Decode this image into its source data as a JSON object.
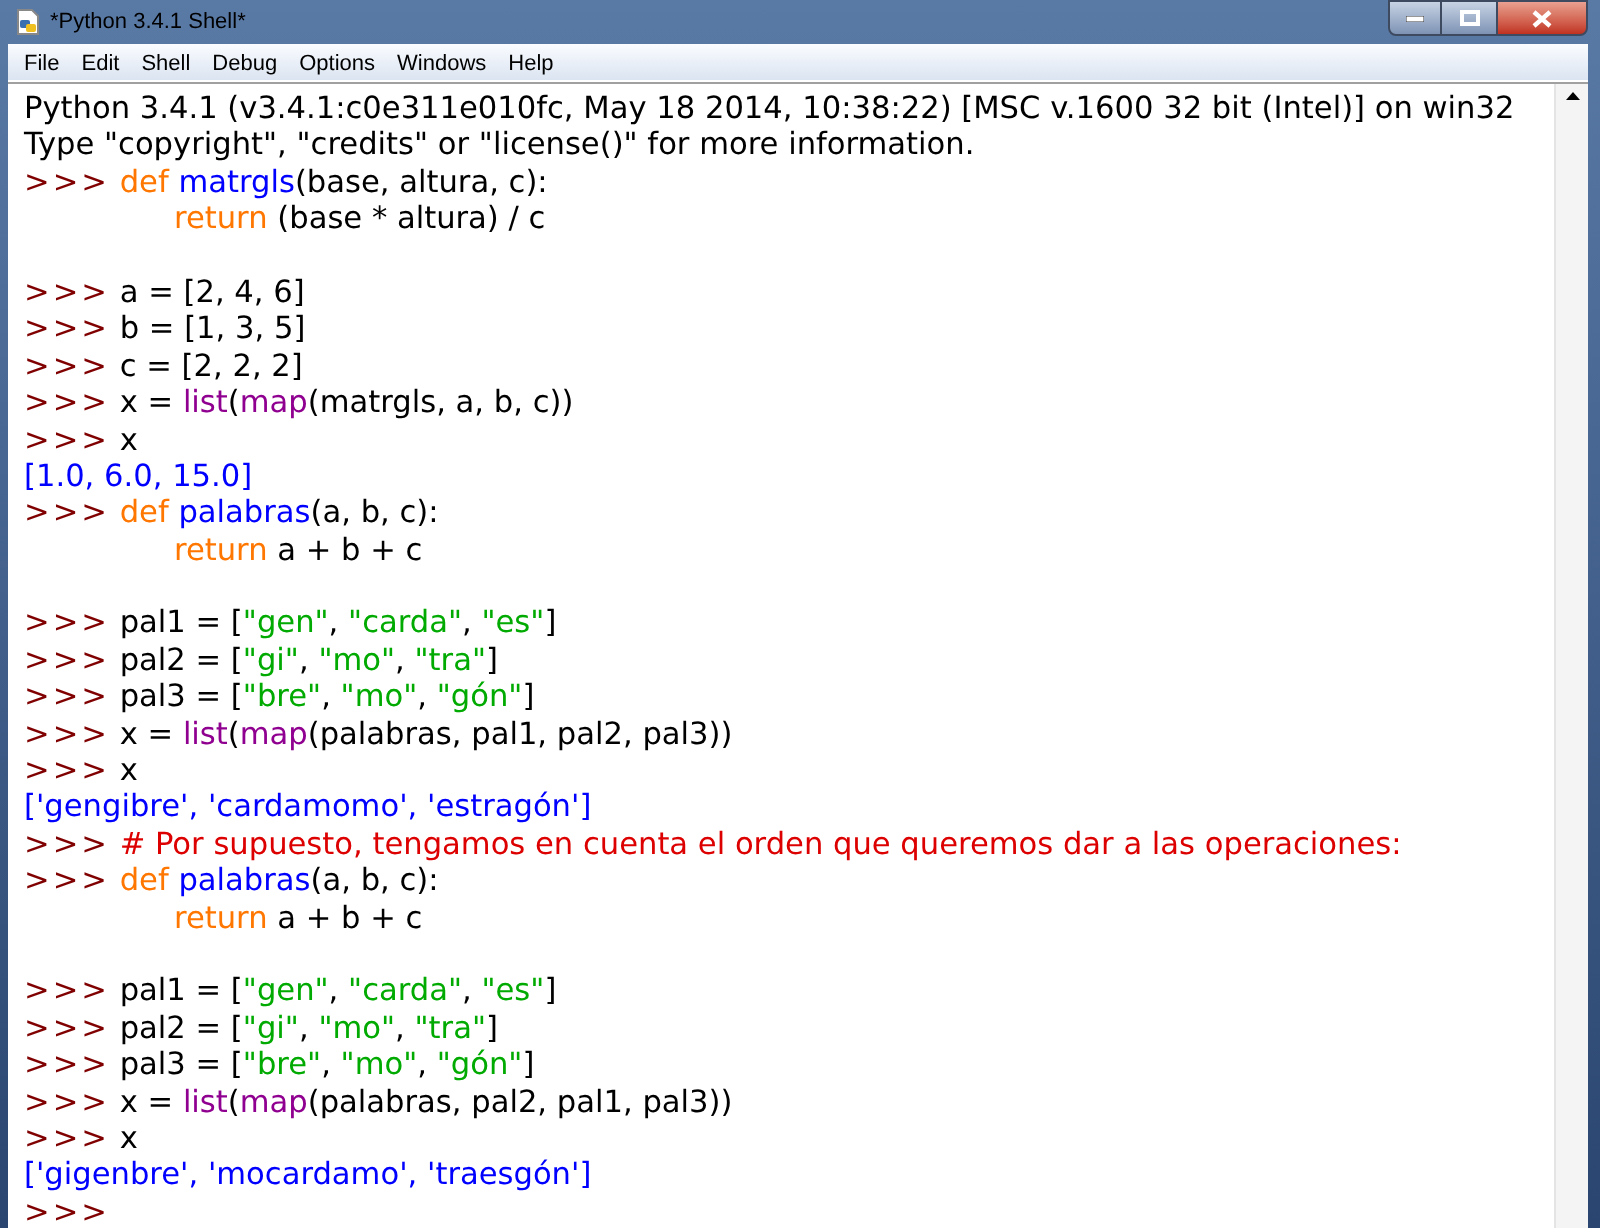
{
  "window": {
    "title": "*Python 3.4.1 Shell*"
  },
  "menu": [
    {
      "label": "File"
    },
    {
      "label": "Edit"
    },
    {
      "label": "Shell"
    },
    {
      "label": "Debug"
    },
    {
      "label": "Options"
    },
    {
      "label": "Windows"
    },
    {
      "label": "Help"
    }
  ],
  "lines": [
    {
      "kind": "banner",
      "tokens": [
        {
          "text": "Python 3.4.1 (v3.4.1:c0e311e010fc, May 18 2014, 10:38:22) [MSC v.1600 32 bit (Intel)] on win32",
          "kind": "plain"
        }
      ]
    },
    {
      "kind": "banner",
      "tokens": [
        {
          "text": "Type \"copyright\", \"credits\" or \"license()\" for more information.",
          "kind": "plain"
        }
      ]
    },
    {
      "kind": "input",
      "prompt": ">>>",
      "tokens": [
        {
          "text": "def",
          "kind": "keyword"
        },
        {
          "text": " matrgls",
          "kind": "definition"
        },
        {
          "text": "(base, altura, c):",
          "kind": "plain"
        }
      ]
    },
    {
      "kind": "continuation",
      "tokens": [
        {
          "text": "return",
          "kind": "keyword"
        },
        {
          "text": " (base * altura) / c",
          "kind": "plain"
        }
      ]
    },
    {
      "kind": "blank"
    },
    {
      "kind": "input",
      "prompt": ">>>",
      "tokens": [
        {
          "text": "a = [2, 4, 6]",
          "kind": "plain"
        }
      ]
    },
    {
      "kind": "input",
      "prompt": ">>>",
      "tokens": [
        {
          "text": "b = [1, 3, 5]",
          "kind": "plain"
        }
      ]
    },
    {
      "kind": "input",
      "prompt": ">>>",
      "tokens": [
        {
          "text": "c = [2, 2, 2]",
          "kind": "plain"
        }
      ]
    },
    {
      "kind": "input",
      "prompt": ">>>",
      "tokens": [
        {
          "text": "x = ",
          "kind": "plain"
        },
        {
          "text": "list",
          "kind": "builtin"
        },
        {
          "text": "(",
          "kind": "plain"
        },
        {
          "text": "map",
          "kind": "builtin"
        },
        {
          "text": "(matrgls, a, b, c))",
          "kind": "plain"
        }
      ]
    },
    {
      "kind": "input",
      "prompt": ">>>",
      "tokens": [
        {
          "text": "x",
          "kind": "plain"
        }
      ]
    },
    {
      "kind": "output",
      "tokens": [
        {
          "text": "[1.0, 6.0, 15.0]",
          "kind": "output"
        }
      ]
    },
    {
      "kind": "input",
      "prompt": ">>>",
      "tokens": [
        {
          "text": "def",
          "kind": "keyword"
        },
        {
          "text": " palabras",
          "kind": "definition"
        },
        {
          "text": "(a, b, c):",
          "kind": "plain"
        }
      ]
    },
    {
      "kind": "continuation",
      "tokens": [
        {
          "text": "return",
          "kind": "keyword"
        },
        {
          "text": " a + b + c",
          "kind": "plain"
        }
      ]
    },
    {
      "kind": "blank"
    },
    {
      "kind": "input",
      "prompt": ">>>",
      "tokens": [
        {
          "text": "pal1 = [",
          "kind": "plain"
        },
        {
          "text": "\"gen\"",
          "kind": "string"
        },
        {
          "text": ", ",
          "kind": "plain"
        },
        {
          "text": "\"carda\"",
          "kind": "string"
        },
        {
          "text": ", ",
          "kind": "plain"
        },
        {
          "text": "\"es\"",
          "kind": "string"
        },
        {
          "text": "]",
          "kind": "plain"
        }
      ]
    },
    {
      "kind": "input",
      "prompt": ">>>",
      "tokens": [
        {
          "text": "pal2 = [",
          "kind": "plain"
        },
        {
          "text": "\"gi\"",
          "kind": "string"
        },
        {
          "text": ", ",
          "kind": "plain"
        },
        {
          "text": "\"mo\"",
          "kind": "string"
        },
        {
          "text": ", ",
          "kind": "plain"
        },
        {
          "text": "\"tra\"",
          "kind": "string"
        },
        {
          "text": "]",
          "kind": "plain"
        }
      ]
    },
    {
      "kind": "input",
      "prompt": ">>>",
      "tokens": [
        {
          "text": "pal3 = [",
          "kind": "plain"
        },
        {
          "text": "\"bre\"",
          "kind": "string"
        },
        {
          "text": ", ",
          "kind": "plain"
        },
        {
          "text": "\"mo\"",
          "kind": "string"
        },
        {
          "text": ", ",
          "kind": "plain"
        },
        {
          "text": "\"gón\"",
          "kind": "string"
        },
        {
          "text": "]",
          "kind": "plain"
        }
      ]
    },
    {
      "kind": "input",
      "prompt": ">>>",
      "tokens": [
        {
          "text": "x = ",
          "kind": "plain"
        },
        {
          "text": "list",
          "kind": "builtin"
        },
        {
          "text": "(",
          "kind": "plain"
        },
        {
          "text": "map",
          "kind": "builtin"
        },
        {
          "text": "(palabras, pal1, pal2, pal3))",
          "kind": "plain"
        }
      ]
    },
    {
      "kind": "input",
      "prompt": ">>>",
      "tokens": [
        {
          "text": "x",
          "kind": "plain"
        }
      ]
    },
    {
      "kind": "output",
      "tokens": [
        {
          "text": "['gengibre', 'cardamomo', 'estragón']",
          "kind": "output"
        }
      ]
    },
    {
      "kind": "input",
      "prompt": ">>>",
      "tokens": [
        {
          "text": "# Por supuesto, tengamos en cuenta el orden que queremos dar a las operaciones:",
          "kind": "comment"
        }
      ]
    },
    {
      "kind": "input",
      "prompt": ">>>",
      "tokens": [
        {
          "text": "def",
          "kind": "keyword"
        },
        {
          "text": " palabras",
          "kind": "definition"
        },
        {
          "text": "(a, b, c):",
          "kind": "plain"
        }
      ]
    },
    {
      "kind": "continuation",
      "tokens": [
        {
          "text": "return",
          "kind": "keyword"
        },
        {
          "text": " a + b + c",
          "kind": "plain"
        }
      ]
    },
    {
      "kind": "blank"
    },
    {
      "kind": "input",
      "prompt": ">>>",
      "tokens": [
        {
          "text": "pal1 = [",
          "kind": "plain"
        },
        {
          "text": "\"gen\"",
          "kind": "string"
        },
        {
          "text": ", ",
          "kind": "plain"
        },
        {
          "text": "\"carda\"",
          "kind": "string"
        },
        {
          "text": ", ",
          "kind": "plain"
        },
        {
          "text": "\"es\"",
          "kind": "string"
        },
        {
          "text": "]",
          "kind": "plain"
        }
      ]
    },
    {
      "kind": "input",
      "prompt": ">>>",
      "tokens": [
        {
          "text": "pal2 = [",
          "kind": "plain"
        },
        {
          "text": "\"gi\"",
          "kind": "string"
        },
        {
          "text": ", ",
          "kind": "plain"
        },
        {
          "text": "\"mo\"",
          "kind": "string"
        },
        {
          "text": ", ",
          "kind": "plain"
        },
        {
          "text": "\"tra\"",
          "kind": "string"
        },
        {
          "text": "]",
          "kind": "plain"
        }
      ]
    },
    {
      "kind": "input",
      "prompt": ">>>",
      "tokens": [
        {
          "text": "pal3 = [",
          "kind": "plain"
        },
        {
          "text": "\"bre\"",
          "kind": "string"
        },
        {
          "text": ", ",
          "kind": "plain"
        },
        {
          "text": "\"mo\"",
          "kind": "string"
        },
        {
          "text": ", ",
          "kind": "plain"
        },
        {
          "text": "\"gón\"",
          "kind": "string"
        },
        {
          "text": "]",
          "kind": "plain"
        }
      ]
    },
    {
      "kind": "input",
      "prompt": ">>>",
      "tokens": [
        {
          "text": "x = ",
          "kind": "plain"
        },
        {
          "text": "list",
          "kind": "builtin"
        },
        {
          "text": "(",
          "kind": "plain"
        },
        {
          "text": "map",
          "kind": "builtin"
        },
        {
          "text": "(palabras, pal2, pal1, pal3))",
          "kind": "plain"
        }
      ]
    },
    {
      "kind": "input",
      "prompt": ">>>",
      "tokens": [
        {
          "text": "x",
          "kind": "plain"
        }
      ]
    },
    {
      "kind": "output",
      "tokens": [
        {
          "text": "['gigenbre', 'mocardamo', 'traesgón']",
          "kind": "output"
        }
      ]
    },
    {
      "kind": "input",
      "prompt": ">>>"
    }
  ]
}
